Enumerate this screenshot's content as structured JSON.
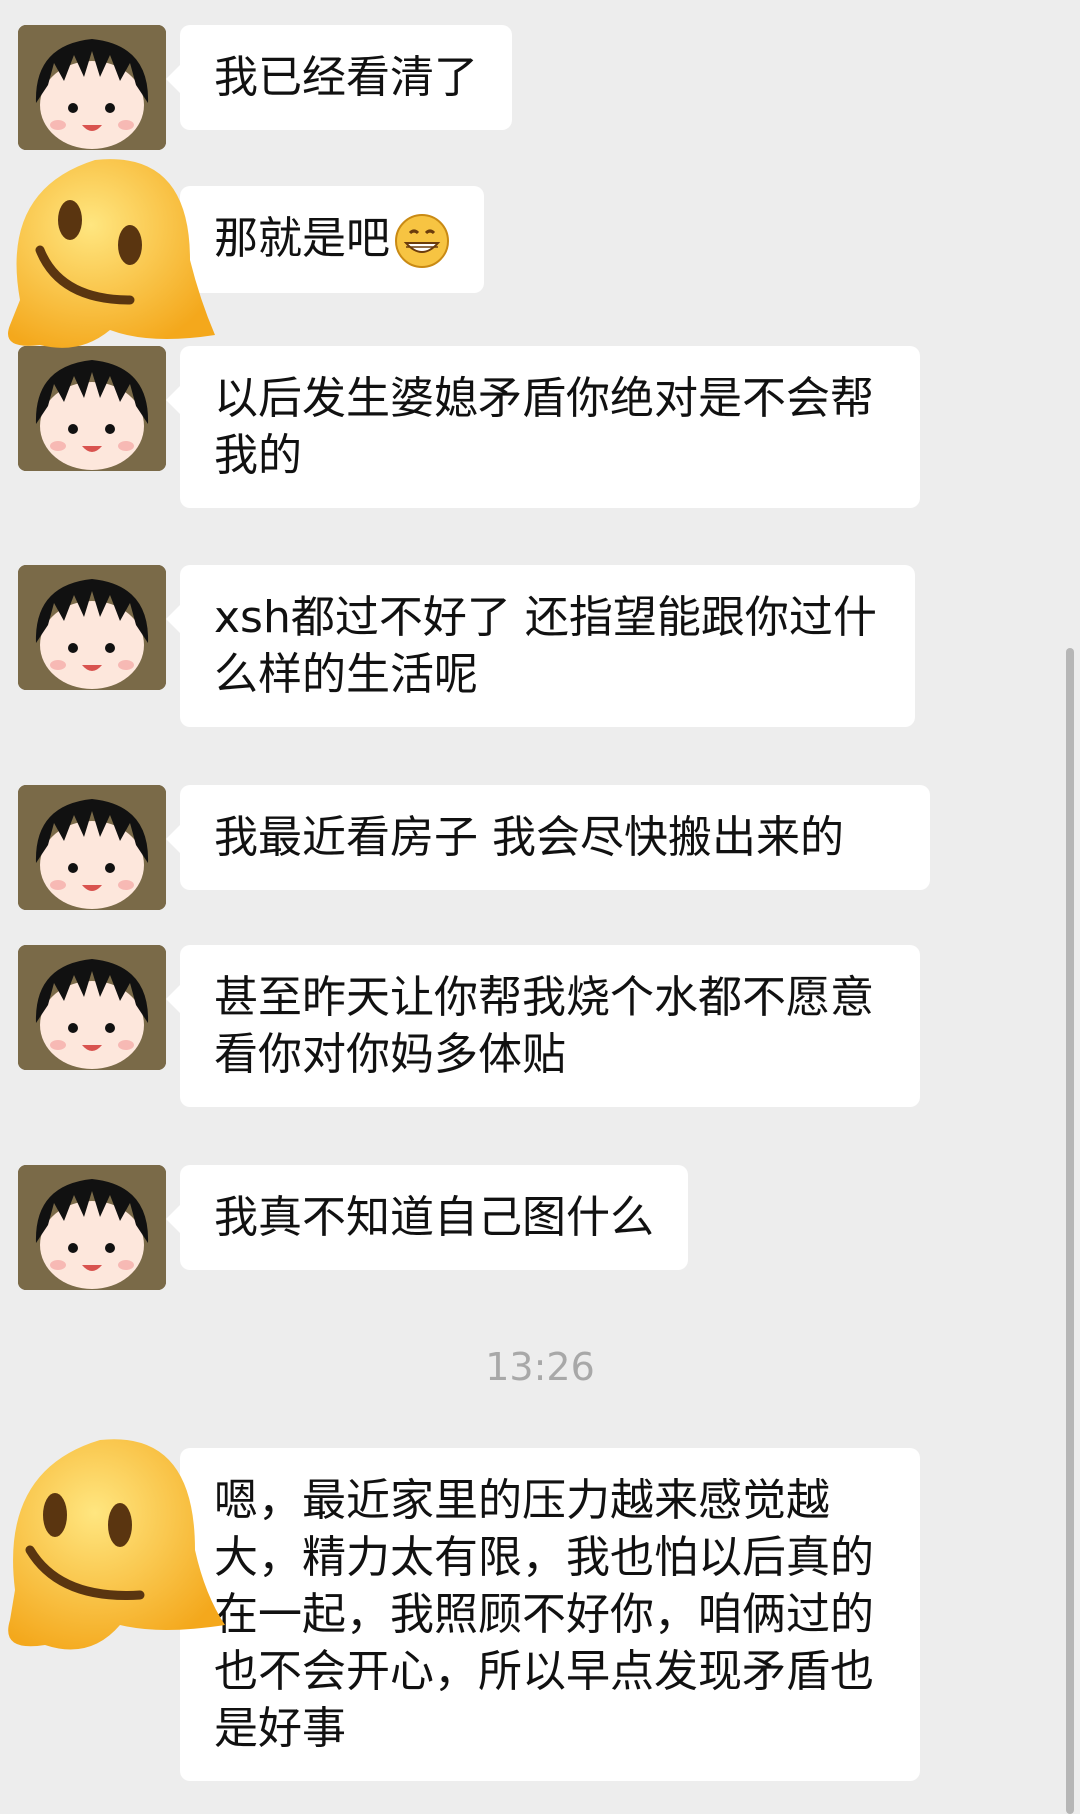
{
  "messages": [
    {
      "text": "我已经看清了"
    },
    {
      "text": "那就是吧",
      "emoji": "grinning-emoji"
    },
    {
      "text": "以后发生婆媳矛盾你绝对是不会帮我的"
    },
    {
      "text": "xsh都过不好了 还指望能跟你过什么样的生活呢"
    },
    {
      "text": "我最近看房子 我会尽快搬出来的"
    },
    {
      "text": "甚至昨天让你帮我烧个水都不愿意 看你对你妈多体贴"
    },
    {
      "text": "我真不知道自己图什么"
    }
  ],
  "timestamp": "13:26",
  "last_message": {
    "text": "嗯，最近家里的压力越来感觉越大，精力太有限，我也怕以后真的在一起，我照顾不好你，咱俩过的也不会开心，所以早点发现矛盾也是好事"
  },
  "icons": {
    "avatar": "maruko-avatar-icon",
    "melting": "melting-face-emoji"
  }
}
